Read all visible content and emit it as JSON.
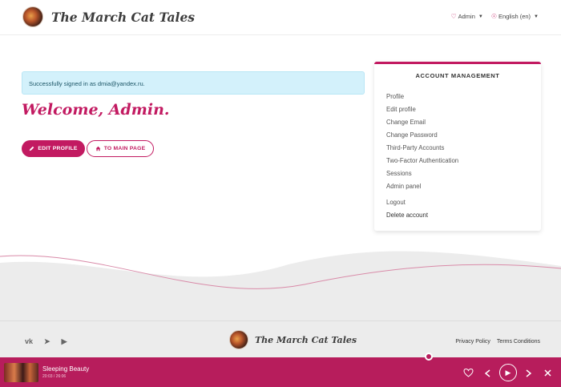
{
  "header": {
    "site_title": "The March Cat Tales",
    "user_menu_label": "Admin",
    "language_label": "English (en)"
  },
  "main": {
    "alert_text": "Successfully signed in as dmia@yandex.ru.",
    "welcome_text": "Welcome, Admin.",
    "edit_profile_label": "EDIT PROFILE",
    "main_page_label": "TO MAIN PAGE"
  },
  "account": {
    "title": "ACCOUNT MANAGEMENT",
    "links": [
      "Profile",
      "Edit profile",
      "Change Email",
      "Change Password",
      "Third-Party Accounts",
      "Two-Factor Authentication",
      "Sessions",
      "Admin panel"
    ],
    "logout_label": "Logout",
    "delete_label": "Delete account"
  },
  "footer": {
    "site_title": "The March Cat Tales",
    "privacy_label": "Privacy Policy",
    "terms_label": "Terms Conditions",
    "social_icons": [
      "vk-icon",
      "telegram-icon",
      "youtube-icon"
    ]
  },
  "player": {
    "track_title": "Sleeping Beauty",
    "track_time": "20:03 / 26:06"
  },
  "colors": {
    "accent": "#c21a61",
    "player_bg": "#b71d5c",
    "alert_bg": "#d3f1fb"
  }
}
